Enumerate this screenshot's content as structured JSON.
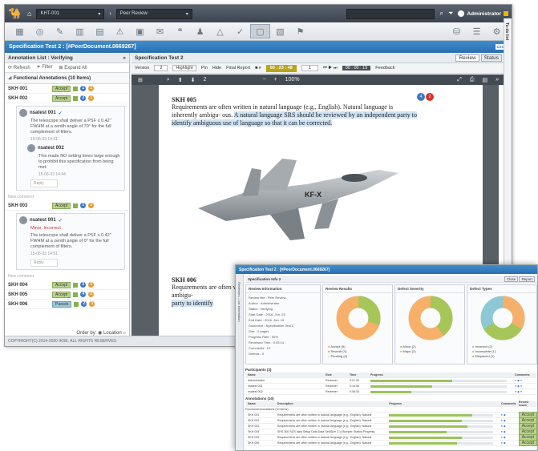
{
  "window1": {
    "topbar": {
      "project": "KHT-001",
      "view": "Peer Review",
      "user": "Administrator"
    },
    "title": "Specification Test 2 : [#PeerDocument.0669267]",
    "left": {
      "header": "Annotation List : Verifying",
      "tools": [
        "Refresh",
        "Filter",
        "Expand All"
      ],
      "section": "Functional Annotations (10 Items)",
      "rows": [
        {
          "id": "SKH 001",
          "status": "Accept"
        },
        {
          "id": "SKH 002",
          "status": "Accept"
        },
        {
          "id": "SKH 003",
          "status": "Accept"
        },
        {
          "id": "SKH 004",
          "status": "Accept"
        },
        {
          "id": "SKH 005",
          "status": "Accept"
        },
        {
          "id": "SKH 006",
          "status": "Pascek"
        }
      ],
      "comments": [
        {
          "author": "nsatest 001",
          "text": "The telescope shall deliver a PSF ≤ 0.42\" FWHM at a zenith angle of 70° for the full complement of filters.",
          "date": "15-06-03 14:31"
        },
        {
          "author": "nsatest 002",
          "text": "This made NO setting times large enough to prohibit this specification from being met.",
          "date": "15-06-03 14:44"
        },
        {
          "author": "nsatest 001",
          "tag": "Minor, Incorrect",
          "text": "The telescope shall deliver a PSF ≤ 0.42\" FWHM at a zenith angle of 0° for the full complement of filters.",
          "date": "15-06-03 14:51"
        }
      ],
      "reply": "Reply",
      "new_comment": "New comment",
      "order_by": "Order by:",
      "order_value": "Location"
    },
    "center": {
      "header": "Specification Test 2",
      "review": "Review",
      "status": "Status",
      "version_label": "Version",
      "version": "2",
      "highlight": "Highlight",
      "pin": "Pin",
      "hide": "Hide",
      "final_report": "Final Report",
      "timer1": "00 : 23 : 48",
      "timer2": "00 : 00 : 15",
      "page": "1",
      "feedback": "Feedback",
      "page_of": "2",
      "zoom": "100%"
    },
    "doc": {
      "sec1": "SKH 005",
      "req1a": "Requirements are often written in natural language (e.g., English). Natural language is inherently ambigu- ous.",
      "req1b": "A natural language SRS should be reviewed by an independent party to identify ambiguous use of language so that it can be corrected.",
      "sec2": "SKH 006",
      "req2": "Requirements are often written in natural language (e.g., English). Natural language is inherently ambigu-",
      "req2b": "party to identify",
      "badge_a": "4",
      "badge_b": "2"
    },
    "side_label": "To-do list",
    "footer": "COPYRIGHT(C) 2014-2020 IKSE. ALL RIGHTS RESERVED."
  },
  "window2": {
    "title": "Specification Test 2 : [#PeerDocument.0669267]",
    "side_label": "Reviewers - List Information",
    "info_title": "Specification Info 2",
    "btns": [
      "Close",
      "Report"
    ],
    "info_card": "Review Information",
    "info": [
      "Review title : Peer Review",
      "Author : Administrator",
      "Status : Verifying",
      "Start Date : 2016. Jun. 03",
      "End Date : 2016. Jun. 15",
      "Document : Specification Test 2",
      "Size : 2 pages",
      "Progress Rate : 50%",
      "Reviewed Time : 0:45:14",
      "Comments : 10",
      "Defects : 4"
    ],
    "charts": [
      {
        "title": "Review Results",
        "legend": [
          "Accept (5)",
          "Rework (3)",
          "Pending (2)"
        ]
      },
      {
        "title": "Defect Severity",
        "legend": [
          "Minor (2)",
          "Major (2)"
        ]
      },
      {
        "title": "Defect Types",
        "legend": [
          "Incorrect (2)",
          "Incomplete (1)",
          "Misplaced (1)"
        ]
      }
    ],
    "participants_title": "Participants (3)",
    "participants_head": [
      "Name",
      "Role",
      "Time",
      "Progress",
      "Comments"
    ],
    "participants": [
      {
        "name": "Administrator",
        "role": "Reviewer",
        "time": "0:21:33",
        "progress": 0.6
      },
      {
        "name": "nsatest 001",
        "role": "Reviewer",
        "time": "0:15:06",
        "progress": 0.45
      },
      {
        "name": "nsatest 002",
        "role": "Reviewer",
        "time": "0:08:35",
        "progress": 0.3
      }
    ],
    "annotations_title": "Annotations (10)",
    "annotations_head": [
      "Name",
      "Description",
      "Progress",
      "Comments",
      "Review result"
    ],
    "functional": "Functional Annotations (10 Items)",
    "annotations": [
      {
        "name": "SKH 001",
        "desc": "Requirements are often written in natural language (e.g., English). Natural",
        "progress": 0.8,
        "result": "Accept"
      },
      {
        "name": "SKH 002",
        "desc": "Requirements are often written in natural language (e.g., English). Natural",
        "progress": 0.7,
        "result": "Accept"
      },
      {
        "name": "SKH 003",
        "desc": "Requirements are often written in natural language (e.g., English). Natural",
        "progress": 0.75,
        "result": "Accept"
      },
      {
        "name": "SKH 004",
        "desc": "SRS 300 SGS data Setup Data Data Set(Size 3.1) Bumper Station Progress",
        "progress": 0.55,
        "result": "Accept"
      },
      {
        "name": "SKH 005",
        "desc": "Requirements are often written in natural language (e.g., English). Natural",
        "progress": 0.7,
        "result": "Accept"
      },
      {
        "name": "SKH 006",
        "desc": "Requirements are often written in natural language (e.g., English). Natural",
        "progress": 0.65,
        "result": "Accept"
      }
    ]
  }
}
